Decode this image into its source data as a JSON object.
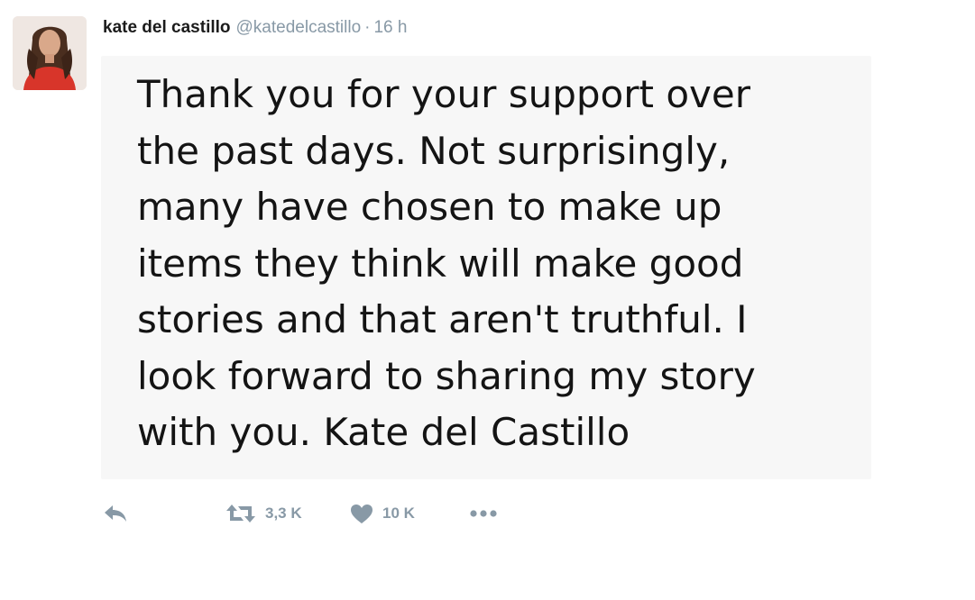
{
  "tweet": {
    "author_name": "kate del castillo",
    "author_handle": "@katedelcastillo",
    "separator": "·",
    "timestamp": "16 h",
    "text": "Thank you for your support over\nthe past days. Not surprisingly,\nmany have chosen to make up\nitems they think will make good\nstories and that aren't truthful. I\nlook forward to sharing my story\nwith you. Kate del Castillo",
    "retweet_count": "3,3 K",
    "like_count": "10 K"
  },
  "icons": {
    "reply": "reply-icon",
    "retweet": "retweet-icon",
    "like": "heart-icon",
    "more": "more-dots-icon"
  },
  "colors": {
    "muted": "#8899a6",
    "text": "#141414",
    "card_background": "#f7f7f7"
  }
}
